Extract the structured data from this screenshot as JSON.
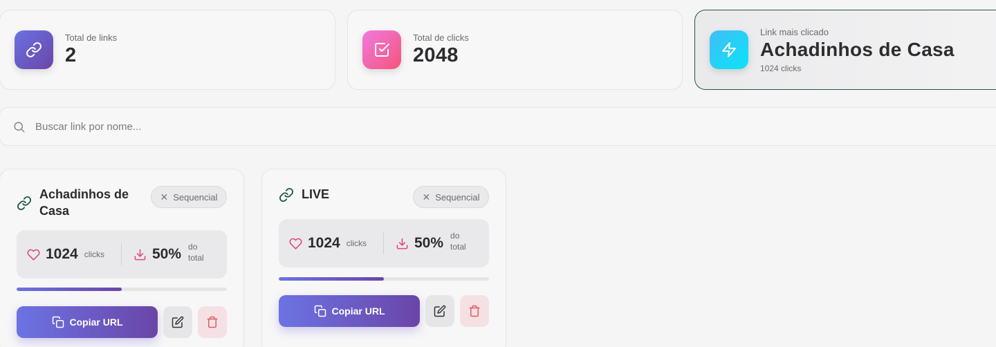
{
  "stats": [
    {
      "label": "Total de links",
      "value": "2",
      "icon": "link-icon",
      "color": "#6a5fd0"
    },
    {
      "label": "Total de clicks",
      "value": "2048",
      "icon": "check-square-icon",
      "color": "#f5608f"
    },
    {
      "label": "Link mais clicado",
      "value": "Achadinhos de Casa",
      "sub": "1024 clicks",
      "icon": "lightning-icon",
      "color": "#24d0f7"
    }
  ],
  "search": {
    "placeholder": "Buscar link por nome..."
  },
  "links": [
    {
      "title": "Achadinhos de Casa",
      "badge": "Sequencial",
      "clicks": "1024",
      "clicks_unit": "clicks",
      "percent": "50%",
      "percent_unit_1": "do",
      "percent_unit_2": "total",
      "progress": 0.5,
      "copy_label": "Copiar URL"
    },
    {
      "title": "LIVE",
      "badge": "Sequencial",
      "clicks": "1024",
      "clicks_unit": "clicks",
      "percent": "50%",
      "percent_unit_1": "do",
      "percent_unit_2": "total",
      "progress": 0.5,
      "copy_label": "Copiar URL"
    }
  ],
  "colors": {
    "accent": "#6b5fd6",
    "pink": "#e0457a",
    "green": "#1f5a3a",
    "danger": "#e05a6a"
  }
}
